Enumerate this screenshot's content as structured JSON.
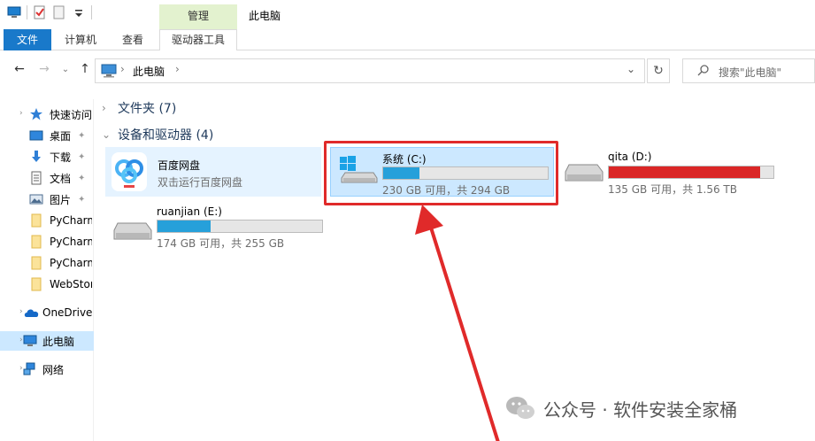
{
  "titlebar": {
    "manage_tab": "管理",
    "window_title": "此电脑"
  },
  "ribbon": {
    "tabs": [
      "文件",
      "计算机",
      "查看",
      "驱动器工具"
    ]
  },
  "address": {
    "path_label": "此电脑",
    "search_placeholder": "搜索\"此电脑\""
  },
  "sidebar": {
    "items": [
      {
        "label": "快速访问",
        "icon": "star-icon"
      },
      {
        "label": "桌面",
        "icon": "desktop-icon",
        "pinned": true
      },
      {
        "label": "下载",
        "icon": "download-icon",
        "pinned": true
      },
      {
        "label": "文档",
        "icon": "document-icon",
        "pinned": true
      },
      {
        "label": "图片",
        "icon": "picture-icon",
        "pinned": true
      },
      {
        "label": "PyCharm",
        "icon": "folder-icon"
      },
      {
        "label": "PyCharm",
        "icon": "folder-icon"
      },
      {
        "label": "PyCharm",
        "icon": "folder-icon"
      },
      {
        "label": "WebStorm",
        "icon": "folder-icon"
      },
      {
        "label": "OneDrive",
        "icon": "cloud-icon"
      },
      {
        "label": "此电脑",
        "icon": "computer-icon",
        "selected": true
      },
      {
        "label": "网络",
        "icon": "network-icon"
      }
    ]
  },
  "main": {
    "folders_header": "文件夹 (7)",
    "devices_header": "设备和驱动器 (4)",
    "baidu": {
      "name": "百度网盘",
      "subtitle": "双击运行百度网盘"
    },
    "drives": [
      {
        "name": "系统 (C:)",
        "info": "230 GB 可用，共 294 GB",
        "used_fraction": 0.22,
        "color": "#26a0da"
      },
      {
        "name": "qita (D:)",
        "info": "135 GB 可用，共 1.56 TB",
        "used_fraction": 0.92,
        "color": "#da2626"
      },
      {
        "name": "ruanjian (E:)",
        "info": "174 GB 可用，共 255 GB",
        "used_fraction": 0.32,
        "color": "#26a0da"
      }
    ]
  },
  "watermark": {
    "text": "公众号 · 软件安装全家桶"
  },
  "colors": {
    "accent": "#1979ca",
    "selection": "#cce8ff",
    "highlight": "#e02a2a"
  }
}
